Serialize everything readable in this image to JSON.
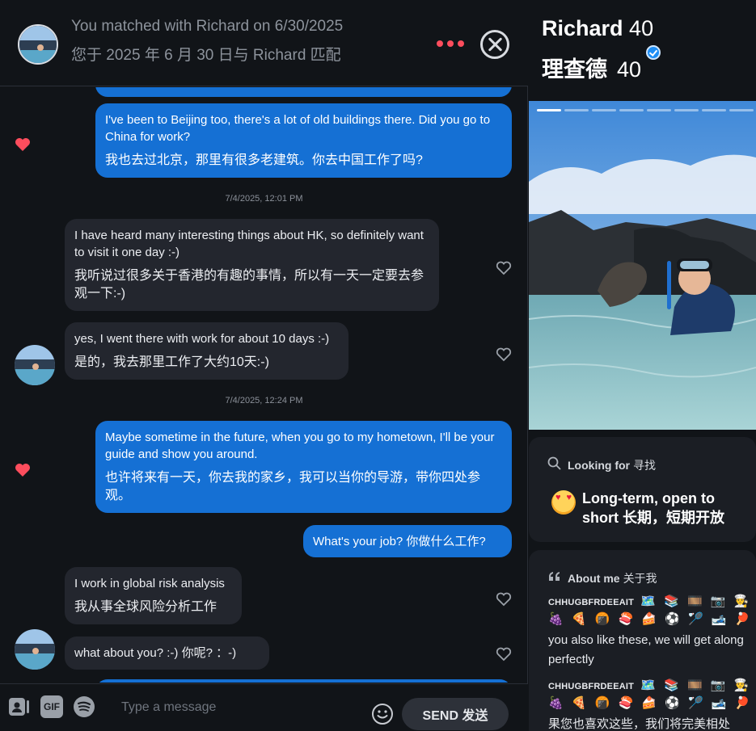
{
  "header": {
    "line1": "You matched with Richard on 6/30/2025",
    "line2": "您于 2025 年 6 月 30 日与 Richard 匹配"
  },
  "messages": {
    "m1_en": "I've been to Beijing too, there's a lot of old buildings there. Did you go to China for work?",
    "m1_zh": "我也去过北京，那里有很多老建筑。你去中国工作了吗?",
    "ts1": "7/4/2025, 12:01 PM",
    "m2_en": "I have heard many interesting things about HK, so definitely want to visit it one day :-)",
    "m2_zh": "我听说过很多关于香港的有趣的事情，所以有一天一定要去参观一下:-)",
    "m3_en": "yes, I went there with work for about 10 days :-)",
    "m3_zh": "是的，我去那里工作了大约10天:-)",
    "ts2": "7/4/2025, 12:24 PM",
    "m4_en": "Maybe sometime in the future, when you go to my hometown, I'll be your guide and show you around.",
    "m4_zh": "也许将来有一天，你去我的家乡，我可以当你的导游，带你四处参观。",
    "m5": "What's your job?  你做什么工作?",
    "m6_en": "I work in global risk analysis",
    "m6_zh": "我从事全球风险分析工作",
    "m7": "what about you? :-)  你呢? ：-)"
  },
  "composer": {
    "gif_label": "GIF",
    "placeholder": "Type a message",
    "send_label": "SEND  发送"
  },
  "profile": {
    "name": "Richard",
    "age": "40",
    "name_zh": "理查德",
    "age_zh": "40",
    "photo_count": 8,
    "photo_active_index": 0,
    "looking_for_title": "Looking for",
    "looking_for_title_zh": "寻找",
    "looking_for_value": "Long-term, open to short  长期，短期开放",
    "about_title": "About me",
    "about_title_zh": "关于我",
    "about_caps_1": "CHHUGBFRDEEAIT",
    "about_emojis_1a": "🗺️ 📚 🎞️ 📷 👨‍🍳",
    "about_emojis_1b": "🍇 🍕 🍘 🍣 🍰 ⚽ 🏸 🎿 🏓 🏒 🏐",
    "about_text_1": "you also like these, we will get along",
    "about_text_2": "perfectly",
    "about_caps_2": "CHHUGBFRDEEAIT",
    "about_emojis_2a": "🗺️ 📚 🎞️ 📷 👨‍🍳",
    "about_emojis_2b": "🍇 🍕 🍘 🍣 🍰 ⚽ 🏸 🎿 🏓 🏒 🏐",
    "about_text_3": "果您也喜欢这些，我们将完美相处"
  },
  "colors": {
    "outgoing_bubble": "#1570d4",
    "incoming_bubble": "#23262e",
    "accent_red": "#fd4d5d",
    "background": "#111418"
  }
}
